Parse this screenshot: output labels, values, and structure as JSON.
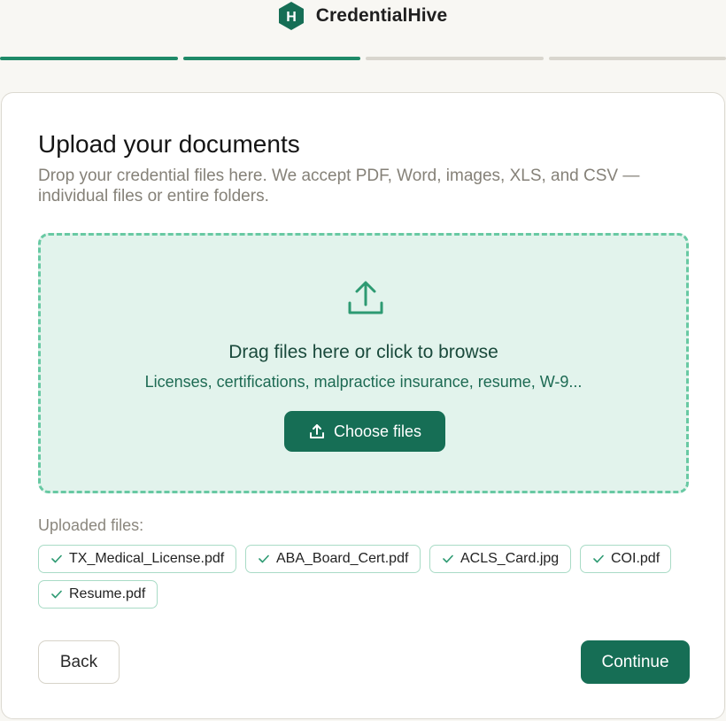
{
  "brand": {
    "name": "CredentialHive",
    "logo_letter": "H",
    "icon": "hexagon-logo-icon"
  },
  "progress": {
    "total_steps": 4,
    "completed_steps": 2
  },
  "page": {
    "title": "Upload your documents",
    "subtitle": "Drop your credential files here. We accept PDF, Word, images, XLS, and CSV — individual files or entire folders."
  },
  "dropzone": {
    "icon": "upload-icon",
    "title": "Drag files here or click to browse",
    "subtitle": "Licenses, certifications, malpractice insurance, resume, W-9...",
    "button_label": "Choose files"
  },
  "uploaded": {
    "label": "Uploaded files:",
    "files": [
      {
        "name": "TX_Medical_License.pdf",
        "status": "check-icon"
      },
      {
        "name": "ABA_Board_Cert.pdf",
        "status": "check-icon"
      },
      {
        "name": "ACLS_Card.jpg",
        "status": "check-icon"
      },
      {
        "name": "COI.pdf",
        "status": "check-icon"
      },
      {
        "name": "Resume.pdf",
        "status": "check-icon"
      }
    ]
  },
  "actions": {
    "back_label": "Back",
    "continue_label": "Continue"
  },
  "colors": {
    "accent": "#166e55",
    "progress_done": "#1f8a68",
    "dropzone_bg": "#e2f3ec",
    "dropzone_border": "#68c9a3"
  }
}
